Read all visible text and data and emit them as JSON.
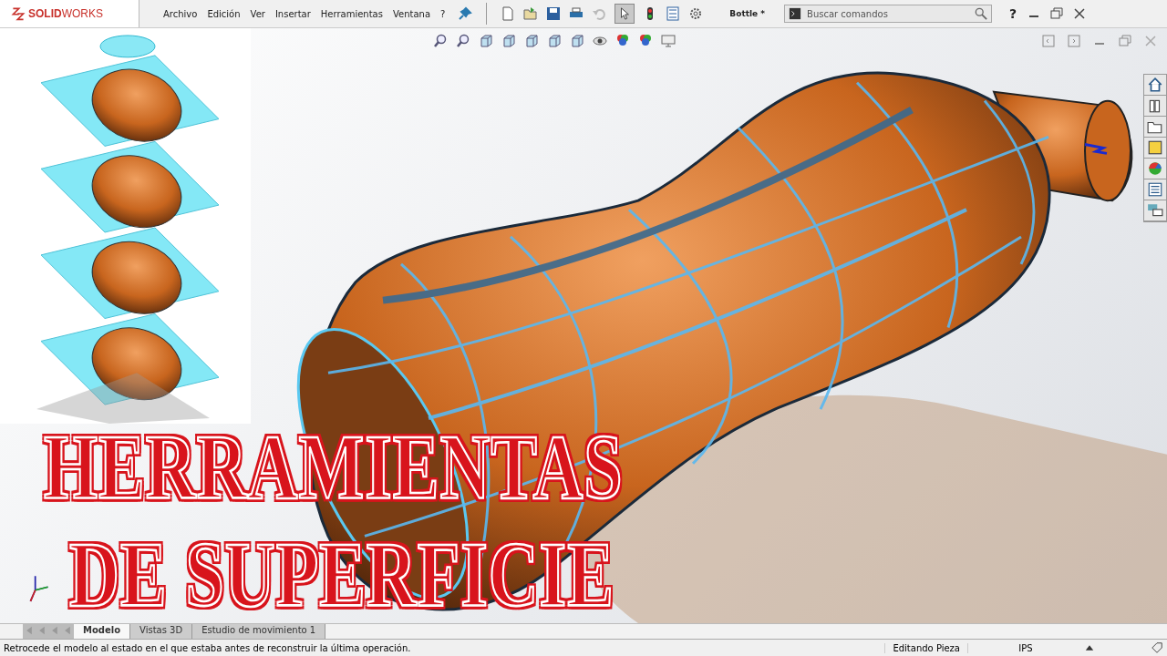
{
  "app_logo": "**SOLID**WORKS",
  "menus": [
    {
      "label": "Archivo"
    },
    {
      "label": "Edición"
    },
    {
      "label": "Ver"
    },
    {
      "label": "Insertar"
    },
    {
      "label": "Herramientas"
    },
    {
      "label": "Ventana"
    },
    {
      "label": "?"
    }
  ],
  "document_title": "Bottle *",
  "search": {
    "placeholder": "Buscar comandos"
  },
  "help": "?",
  "overlay_title": [
    "HERRAMIENTAS",
    "DE SUPERFICIE"
  ],
  "tabs": [
    {
      "label": "Modelo",
      "selected": true
    },
    {
      "label": "Vistas 3D",
      "selected": false
    },
    {
      "label": "Estudio de movimiento 1",
      "selected": false
    }
  ],
  "status_bar": {
    "message": "Retrocede el modelo al estado en el que estaba antes de reconstruir la última operación.",
    "mode": "Editando Pieza",
    "units": "IPS"
  }
}
